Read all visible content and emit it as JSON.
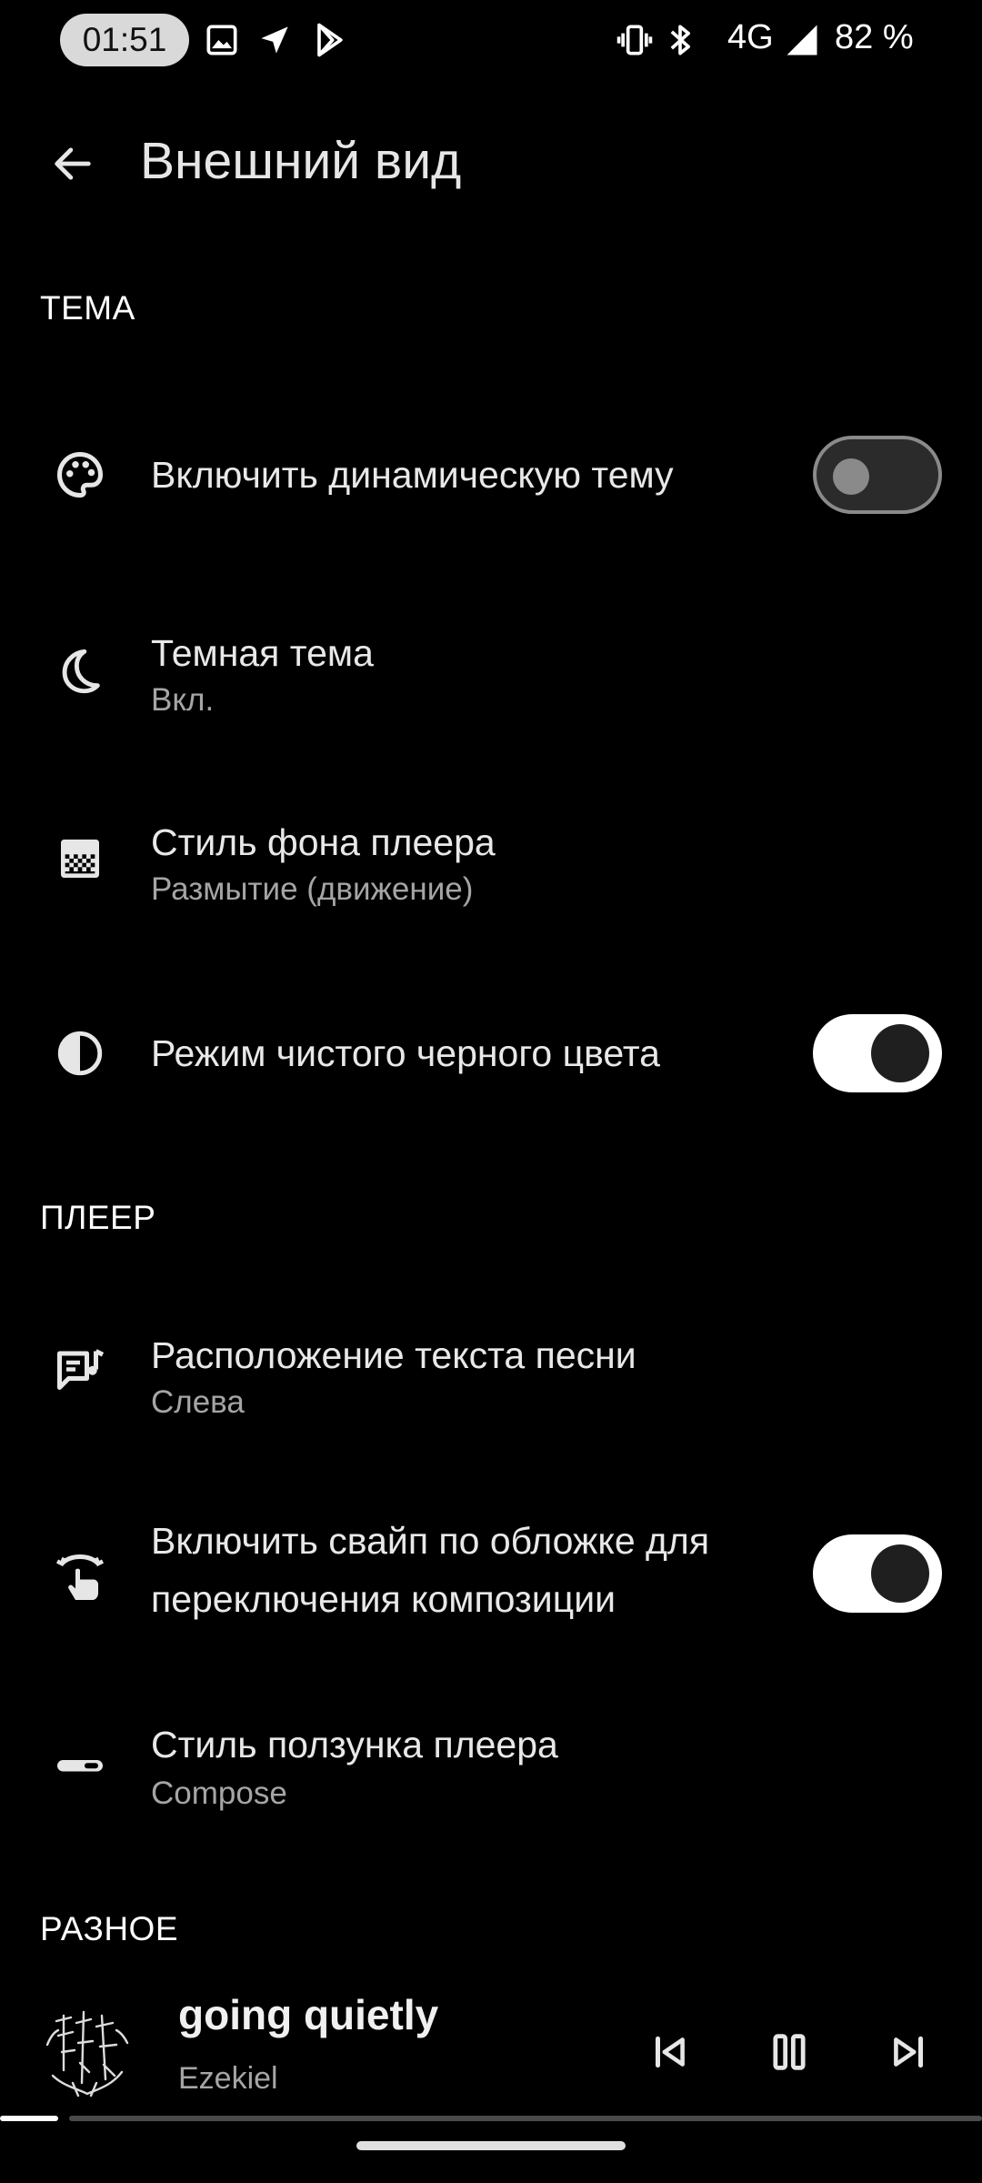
{
  "status_bar": {
    "time": "01:51",
    "network": "4G",
    "battery": "82 %",
    "left_icons": [
      "image-icon",
      "location-arrow-icon",
      "play-store-icon"
    ],
    "right_icons": [
      "vibrate-icon",
      "bluetooth-icon",
      "signal-icon"
    ]
  },
  "header": {
    "title": "Внешний вид"
  },
  "sections": {
    "theme": "ТЕМА",
    "player": "ПЛЕЕР",
    "misc": "РАЗНОЕ"
  },
  "items": {
    "dynamic_theme": {
      "title": "Включить динамическую тему",
      "enabled": false,
      "icon": "palette-icon"
    },
    "dark_theme": {
      "title": "Темная тема",
      "subtitle": "Вкл.",
      "icon": "moon-icon"
    },
    "player_bg": {
      "title": "Стиль фона плеера",
      "subtitle": "Размытие (движение)",
      "icon": "gradient-icon"
    },
    "pure_black": {
      "title": "Режим чистого черного цвета",
      "enabled": true,
      "icon": "contrast-icon"
    },
    "lyrics_pos": {
      "title": "Расположение текста песни",
      "subtitle": "Слева",
      "icon": "lyrics-icon"
    },
    "swipe_cover": {
      "title_line1": "Включить свайп по обложке для",
      "title_line2": "переключения композиции",
      "enabled": true,
      "icon": "swipe-icon"
    },
    "slider_style": {
      "title": "Стиль ползунка плеера",
      "subtitle": "Compose",
      "icon": "slider-icon"
    }
  },
  "mini_player": {
    "title": "going quietly",
    "artist": "Ezekiel",
    "progress": 0.06
  }
}
